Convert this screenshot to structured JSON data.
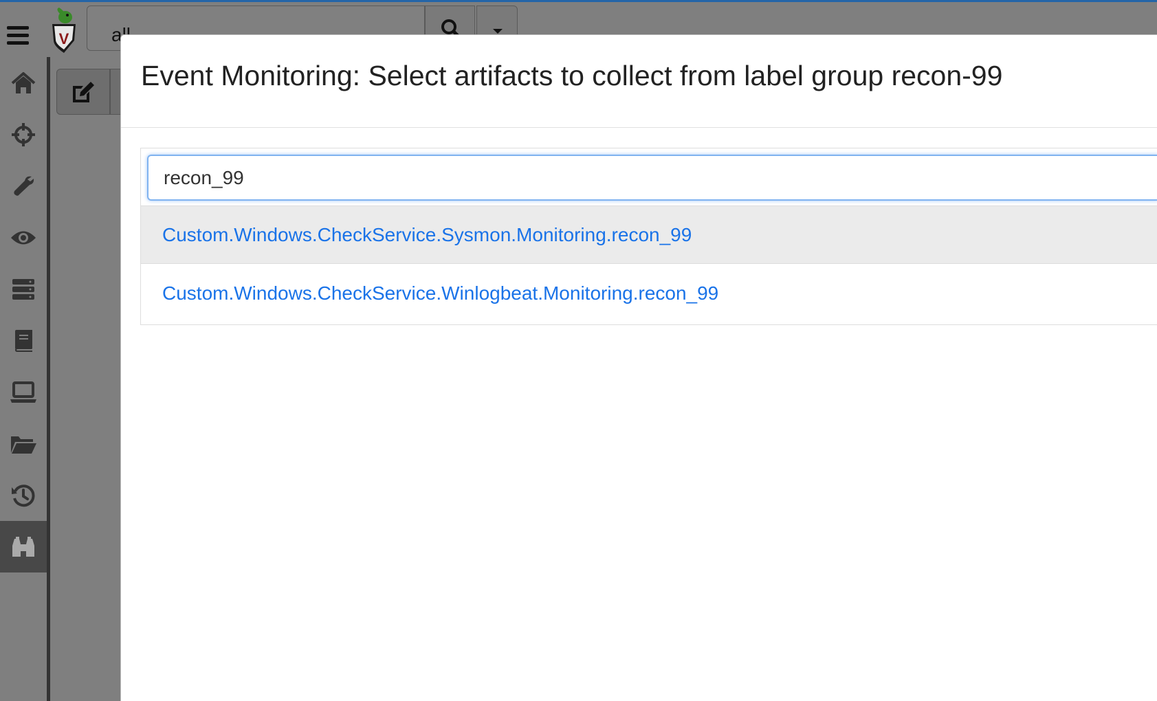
{
  "topbar": {
    "search_value": "all",
    "logo_letter": "V"
  },
  "sidebar": {
    "items": [
      {
        "icon": "home-icon",
        "name": "sidebar-item-home"
      },
      {
        "icon": "crosshairs-icon",
        "name": "sidebar-item-hunt"
      },
      {
        "icon": "wrench-icon",
        "name": "sidebar-item-artifacts"
      },
      {
        "icon": "eye-icon",
        "name": "sidebar-item-events"
      },
      {
        "icon": "server-icon",
        "name": "sidebar-item-server-artifacts"
      },
      {
        "icon": "book-icon",
        "name": "sidebar-item-notebooks"
      },
      {
        "icon": "laptop-icon",
        "name": "sidebar-item-clients"
      },
      {
        "icon": "folder-open-icon",
        "name": "sidebar-item-vfs"
      },
      {
        "icon": "history-icon",
        "name": "sidebar-item-history"
      },
      {
        "icon": "binoculars-icon",
        "name": "sidebar-item-event-monitoring"
      }
    ],
    "active_index": 9
  },
  "modal": {
    "title": "Event Monitoring: Select artifacts to collect from label group recon-99",
    "filter_value": "recon_99",
    "results": [
      "Custom.Windows.CheckService.Sysmon.Monitoring.recon_99",
      "Custom.Windows.CheckService.Winlogbeat.Monitoring.recon_99"
    ],
    "selected_index": 0
  },
  "colors": {
    "link": "#1a73e8",
    "backdrop": "#7f7f7f",
    "frame_accent": "#2465a8",
    "focus_ring": "#80b3f0"
  }
}
